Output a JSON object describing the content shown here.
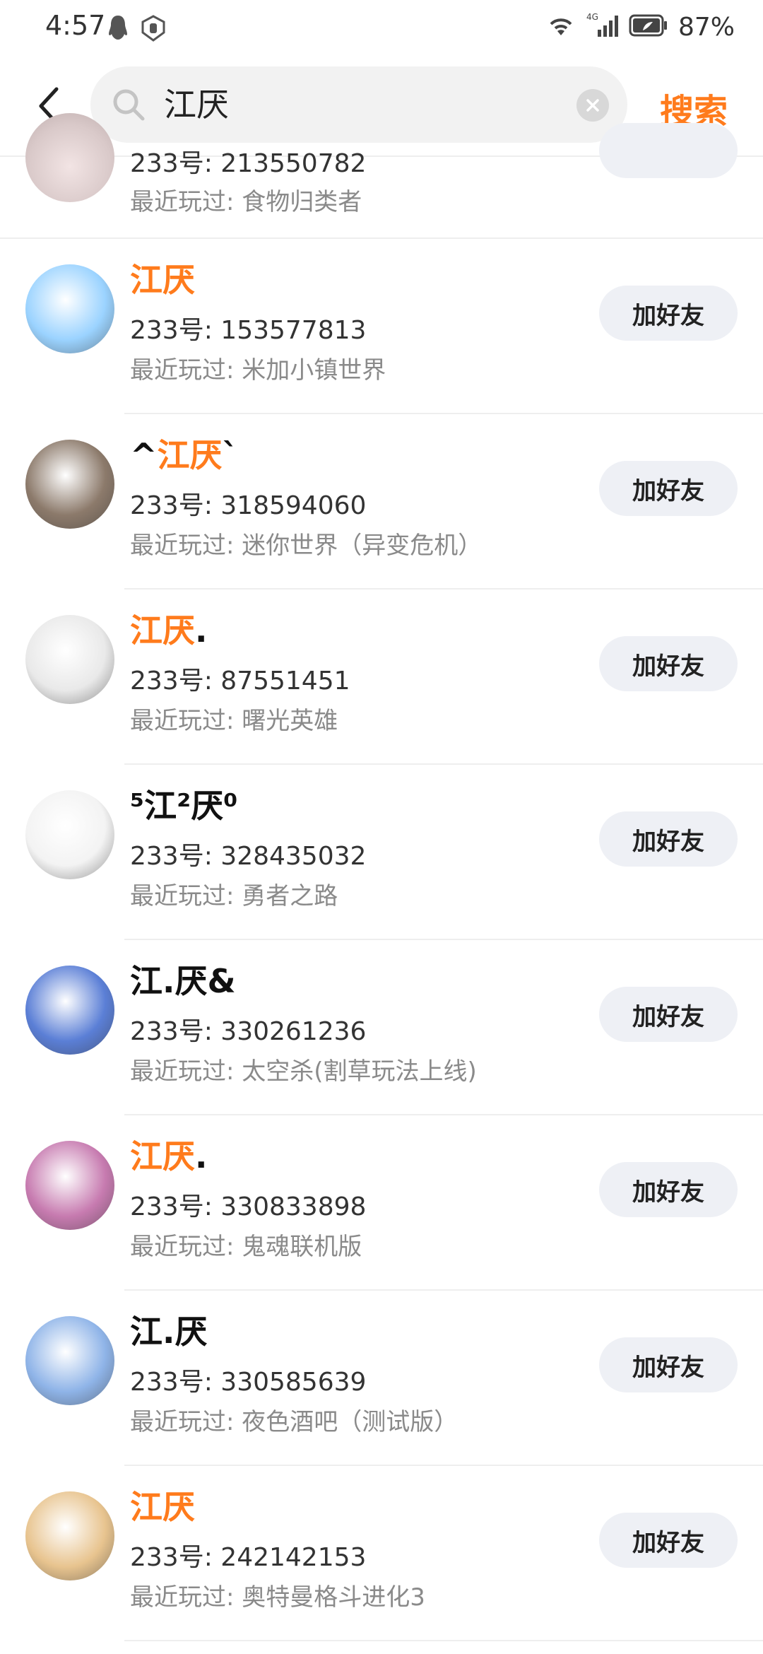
{
  "status_bar": {
    "time": "4:57",
    "battery": "87%",
    "network": "4G"
  },
  "search": {
    "value": "江厌",
    "button_label": "搜索"
  },
  "partial_item": {
    "uid": "233号: 213550782",
    "played": "最近玩过: 食物归类者"
  },
  "results": [
    {
      "name_prefix": "",
      "name_highlight": "江厌",
      "name_suffix": "",
      "uid": "233号: 153577813",
      "played": "最近玩过: 米加小镇世界",
      "button": "加好友",
      "avatar_color": "#9bd3ff"
    },
    {
      "name_prefix": "^",
      "name_highlight": "江厌",
      "name_suffix": "`",
      "uid": "233号: 318594060",
      "played": "最近玩过: 迷你世界（异变危机）",
      "button": "加好友",
      "avatar_color": "#8c7a6b"
    },
    {
      "name_prefix": "",
      "name_highlight": "江厌",
      "name_suffix": ".",
      "uid": "233号: 87551451",
      "played": "最近玩过: 曙光英雄",
      "button": "加好友",
      "avatar_color": "#e9e9e9"
    },
    {
      "name_prefix": "⁵江²厌⁰",
      "name_highlight": "",
      "name_suffix": "",
      "uid": "233号: 328435032",
      "played": "最近玩过: 勇者之路",
      "button": "加好友",
      "avatar_color": "#f3f3f3"
    },
    {
      "name_prefix": "江.厌&",
      "name_highlight": "",
      "name_suffix": "",
      "uid": "233号: 330261236",
      "played": "最近玩过: 太空杀(割草玩法上线)",
      "button": "加好友",
      "avatar_color": "#5b7fd6"
    },
    {
      "name_prefix": "",
      "name_highlight": "江厌",
      "name_suffix": ".",
      "uid": "233号: 330833898",
      "played": "最近玩过: 鬼魂联机版",
      "button": "加好友",
      "avatar_color": "#c77bb0"
    },
    {
      "name_prefix": "江.厌",
      "name_highlight": "",
      "name_suffix": "",
      "uid": "233号: 330585639",
      "played": "最近玩过: 夜色酒吧（测试版）",
      "button": "加好友",
      "avatar_color": "#8fb4e8"
    },
    {
      "name_prefix": "",
      "name_highlight": "江厌",
      "name_suffix": "",
      "uid": "233号: 242142153",
      "played": "最近玩过: 奥特曼格斗进化3",
      "button": "加好友",
      "avatar_color": "#e8c48f"
    }
  ],
  "colors": {
    "accent": "#ff7b1c",
    "button_bg": "#eef0f5"
  }
}
